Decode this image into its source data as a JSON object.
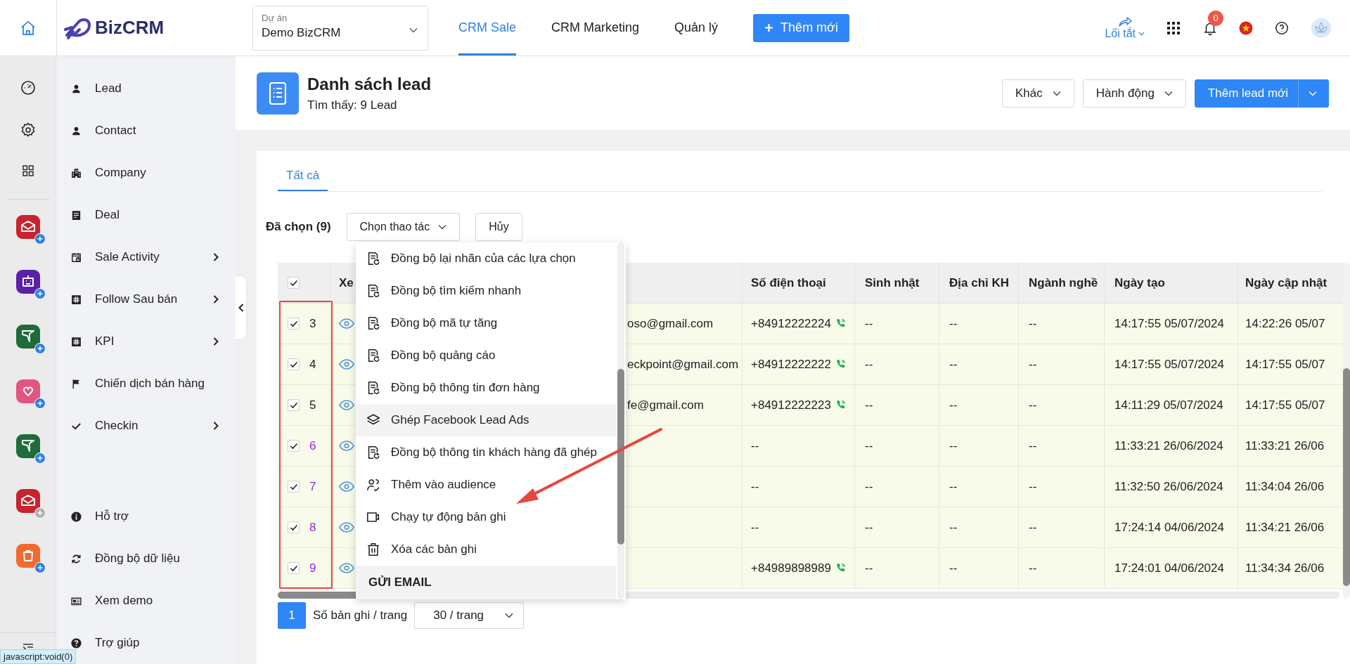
{
  "topbar": {
    "logo": "BizCRM",
    "project": {
      "label": "Dự án",
      "value": "Demo BizCRM"
    },
    "nav": [
      {
        "label": "CRM Sale",
        "selected": true
      },
      {
        "label": "CRM Marketing",
        "selected": false
      },
      {
        "label": "Quản lý",
        "selected": false
      }
    ],
    "add_button": "Thêm mới",
    "shortcut": "Lối tắt",
    "notification_count": "0"
  },
  "rail_apps": [
    {
      "color": "#c8232f",
      "added": true
    },
    {
      "color": "#5b1fa8",
      "added": true
    },
    {
      "color": "#1f6b3a",
      "added": true
    },
    {
      "color": "#e2557e",
      "added": true
    },
    {
      "color": "#1f6b3a",
      "added": true
    },
    {
      "color": "#c8232f",
      "added": false
    },
    {
      "color": "#f26a2e",
      "added": true
    }
  ],
  "sidebar": {
    "items": [
      {
        "label": "Lead",
        "has_submenu": false
      },
      {
        "label": "Contact",
        "has_submenu": false
      },
      {
        "label": "Company",
        "has_submenu": false
      },
      {
        "label": "Deal",
        "has_submenu": false
      },
      {
        "label": "Sale Activity",
        "has_submenu": true
      },
      {
        "label": "Follow Sau bán",
        "has_submenu": true
      },
      {
        "label": "KPI",
        "has_submenu": true
      },
      {
        "label": "Chiến dịch bán hàng",
        "has_submenu": false
      },
      {
        "label": "Checkin",
        "has_submenu": true
      }
    ],
    "footer_items": [
      {
        "label": "Hỗ trợ"
      },
      {
        "label": "Đồng bộ dữ liệu"
      },
      {
        "label": "Xem demo"
      },
      {
        "label": "Trợ giúp"
      }
    ]
  },
  "page": {
    "title": "Danh sách lead",
    "subtitle": "Tìm thấy: 9 Lead",
    "buttons": [
      {
        "label": "Khác",
        "kind": "dropdown"
      },
      {
        "label": "Hành động",
        "kind": "dropdown"
      },
      {
        "label": "Thêm lead mới",
        "kind": "split"
      }
    ]
  },
  "tabs": [
    {
      "label": "Tất cả",
      "selected": true
    }
  ],
  "selection": {
    "count_label": "Đã chọn (9)",
    "action_button": "Chọn thao tác",
    "cancel_button": "Hủy"
  },
  "action_menu": {
    "items": [
      {
        "kind": "item",
        "label": "Đồng bộ lại nhãn của các lựa chọn",
        "selected": false
      },
      {
        "kind": "item",
        "label": "Đồng bộ tìm kiếm nhanh",
        "selected": false
      },
      {
        "kind": "item",
        "label": "Đồng bộ mã tự tăng",
        "selected": false
      },
      {
        "kind": "item",
        "label": "Đồng bộ quảng cáo",
        "selected": false
      },
      {
        "kind": "item",
        "label": "Đồng bộ thông tin đơn hàng",
        "selected": false
      },
      {
        "kind": "item",
        "label": "Ghép Facebook Lead Ads",
        "selected": true
      },
      {
        "kind": "item",
        "label": "Đồng bộ thông tin khách hàng đã ghép",
        "selected": false
      },
      {
        "kind": "item",
        "label": "Thêm vào audience",
        "selected": false
      },
      {
        "kind": "item",
        "label": "Chạy tự động bản ghi",
        "selected": false
      },
      {
        "kind": "item",
        "label": "Xóa các bản ghi",
        "selected": false
      },
      {
        "kind": "section",
        "label": "GỬI EMAIL",
        "selected": false
      }
    ]
  },
  "table": {
    "header_checked": true,
    "columns": [
      {
        "label": "Xe"
      },
      {
        "label": "Số điện thoại"
      },
      {
        "label": "Sinh nhật"
      },
      {
        "label": "Địa chỉ KH"
      },
      {
        "label": "Ngành nghề"
      },
      {
        "label": "Ngày tạo"
      },
      {
        "label": "Ngày cập nhật"
      }
    ],
    "rows": [
      {
        "checked": true,
        "number": "3",
        "color": "#222222",
        "email": "oso@gmail.com",
        "phone": "+84912222224",
        "callable": true,
        "birthday": "--",
        "address": "--",
        "industry": "--",
        "created": "14:17:55 05/07/2024",
        "updated": "14:22:26 05/07"
      },
      {
        "checked": true,
        "number": "4",
        "color": "#222222",
        "email": "eckpoint@gmail.com",
        "phone": "+84912222222",
        "callable": true,
        "birthday": "--",
        "address": "--",
        "industry": "--",
        "created": "14:17:55 05/07/2024",
        "updated": "14:17:55 05/07"
      },
      {
        "checked": true,
        "number": "5",
        "color": "#222222",
        "email": "fe@gmail.com",
        "phone": "+84912222223",
        "callable": true,
        "birthday": "--",
        "address": "--",
        "industry": "--",
        "created": "14:11:29 05/07/2024",
        "updated": "14:17:55 05/07"
      },
      {
        "checked": true,
        "number": "6",
        "color": "#9c27e0",
        "email": "",
        "phone": "--",
        "callable": false,
        "birthday": "--",
        "address": "--",
        "industry": "--",
        "created": "11:33:21 26/06/2024",
        "updated": "11:33:21 26/06"
      },
      {
        "checked": true,
        "number": "7",
        "color": "#9c27e0",
        "email": "",
        "phone": "--",
        "callable": false,
        "birthday": "--",
        "address": "--",
        "industry": "--",
        "created": "11:32:50 26/06/2024",
        "updated": "11:34:04 26/06"
      },
      {
        "checked": true,
        "number": "8",
        "color": "#9c27e0",
        "email": "",
        "phone": "--",
        "callable": false,
        "birthday": "--",
        "address": "--",
        "industry": "--",
        "created": "17:24:14 04/06/2024",
        "updated": "11:34:21 26/06"
      },
      {
        "checked": true,
        "number": "9",
        "color": "#9c27e0",
        "email": "",
        "phone": "+84989898989",
        "callable": true,
        "birthday": "--",
        "address": "--",
        "industry": "--",
        "created": "17:24:01 04/06/2024",
        "updated": "11:34:34 26/06"
      }
    ]
  },
  "pagination": {
    "page": "1",
    "page_size_label": "Số bản ghi / trang",
    "page_size": "30 / trang"
  },
  "status_link": "javascript:void(0)"
}
